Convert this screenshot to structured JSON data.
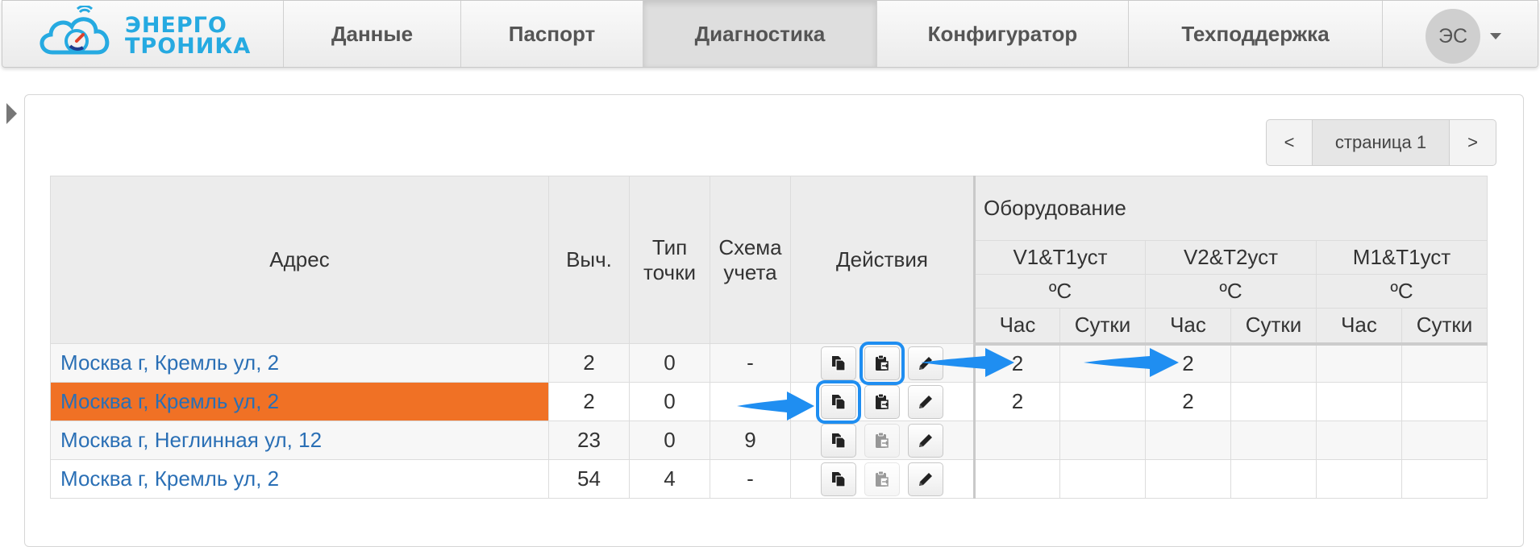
{
  "brand": {
    "logo_line1": "ЭНЕРГО",
    "logo_line2": "ТРОНИКА"
  },
  "nav": {
    "items": [
      {
        "label": "Данные"
      },
      {
        "label": "Паспорт"
      },
      {
        "label": "Диагностика",
        "active": true
      },
      {
        "label": "Конфигуратор"
      },
      {
        "label": "Техподдержка"
      }
    ],
    "user_initials": "ЭС"
  },
  "pager": {
    "prev": "<",
    "page_label": "страница 1",
    "next": ">"
  },
  "table": {
    "headers": {
      "address": "Адрес",
      "calc": "Выч.",
      "point_type": "Тип точки",
      "scheme": "Схема учета",
      "actions": "Действия",
      "equipment": "Оборудование",
      "groups": [
        {
          "name": "V1&T1уст",
          "unit": "ºC"
        },
        {
          "name": "V2&T2уст",
          "unit": "ºC"
        },
        {
          "name": "M1&T1уст",
          "unit": "ºC"
        }
      ],
      "hour": "Час",
      "day": "Сутки"
    },
    "rows": [
      {
        "address": "Москва г, Кремль ул, 2",
        "calc": "2",
        "point_type": "0",
        "scheme": "-",
        "v1_hour": "2",
        "v1_day": "",
        "v2_hour": "2",
        "v2_day": "",
        "m1_hour": "",
        "m1_day": "",
        "paste_enabled": true,
        "highlight": "paste",
        "selected": false
      },
      {
        "address": "Москва г, Кремль ул, 2",
        "calc": "2",
        "point_type": "0",
        "scheme": "",
        "v1_hour": "2",
        "v1_day": "",
        "v2_hour": "2",
        "v2_day": "",
        "m1_hour": "",
        "m1_day": "",
        "paste_enabled": true,
        "highlight": "copy",
        "selected": true
      },
      {
        "address": "Москва г, Неглинная ул, 12",
        "calc": "23",
        "point_type": "0",
        "scheme": "9",
        "v1_hour": "",
        "v1_day": "",
        "v2_hour": "",
        "v2_day": "",
        "m1_hour": "",
        "m1_day": "",
        "paste_enabled": false,
        "highlight": "",
        "selected": false
      },
      {
        "address": "Москва г, Кремль ул, 2",
        "calc": "54",
        "point_type": "4",
        "scheme": "-",
        "v1_hour": "",
        "v1_day": "",
        "v2_hour": "",
        "v2_day": "",
        "m1_hour": "",
        "m1_day": "",
        "paste_enabled": false,
        "highlight": "",
        "selected": false
      }
    ]
  },
  "colors": {
    "accent": "#26aae1",
    "link": "#2a6fb5",
    "selected_row": "#f07125",
    "arrow": "#1f8ef1"
  },
  "icons": {
    "copy": "copy-icon",
    "paste": "paste-icon",
    "edit": "pencil-icon"
  }
}
